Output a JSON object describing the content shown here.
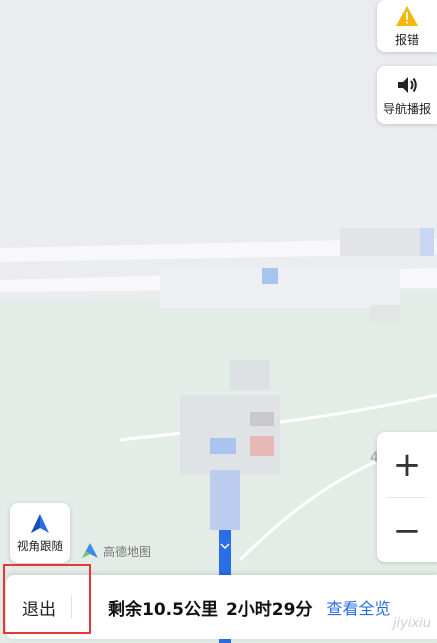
{
  "side_buttons": {
    "report_label": "报错",
    "voice_label": "导航播报"
  },
  "zoom": {
    "in_label": "+",
    "out_label": "−"
  },
  "view_follow": {
    "label": "视角跟随"
  },
  "brand": {
    "label": "高德地图"
  },
  "bottom_bar": {
    "exit_label": "退出",
    "remaining": "剩余10.5公里",
    "time": "2小时29分",
    "overview_label": "查看全览"
  },
  "watermark": "jiyixiu",
  "map_label": "4",
  "colors": {
    "route": "#2a6ee8",
    "accent_link": "#2a6ee8",
    "warning": "#f5b700",
    "highlight": "#e53935"
  }
}
